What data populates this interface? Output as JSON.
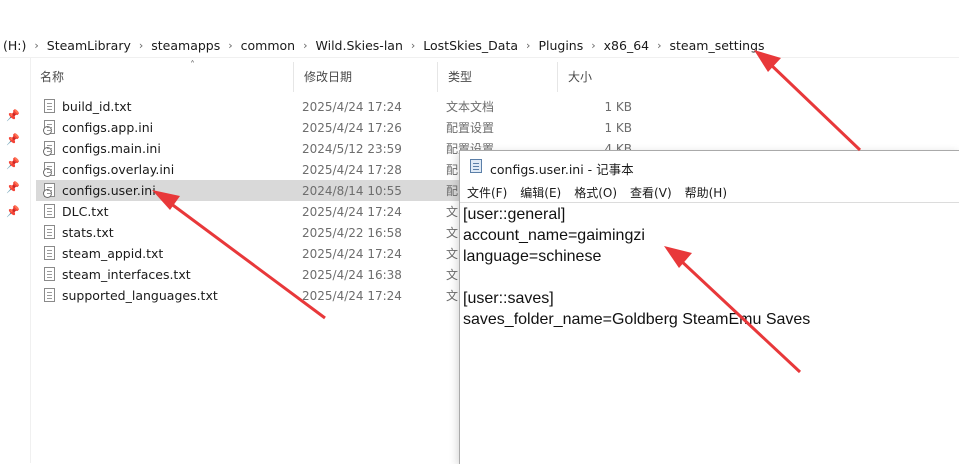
{
  "address": {
    "crumbs": [
      "(H:)",
      "SteamLibrary",
      "steamapps",
      "common",
      "Wild.Skies-lan",
      "LostSkies_Data",
      "Plugins",
      "x86_64",
      "steam_settings"
    ]
  },
  "columns": {
    "name": "名称",
    "date": "修改日期",
    "type": "类型",
    "size": "大小"
  },
  "files": [
    {
      "name": "build_id.txt",
      "date": "2025/4/24 17:24",
      "type": "文本文档",
      "size": "1 KB",
      "icon": "text-file-icon"
    },
    {
      "name": "configs.app.ini",
      "date": "2025/4/24 17:26",
      "type": "配置设置",
      "size": "1 KB",
      "icon": "settings-file-icon"
    },
    {
      "name": "configs.main.ini",
      "date": "2024/5/12 23:59",
      "type": "配置设置",
      "size": "4 KB",
      "icon": "settings-file-icon"
    },
    {
      "name": "configs.overlay.ini",
      "date": "2025/4/24 17:28",
      "type": "配",
      "size": "",
      "icon": "settings-file-icon"
    },
    {
      "name": "configs.user.ini",
      "date": "2024/8/14 10:55",
      "type": "配",
      "size": "",
      "icon": "settings-file-icon",
      "selected": true
    },
    {
      "name": "DLC.txt",
      "date": "2025/4/24 17:24",
      "type": "文",
      "size": "",
      "icon": "text-file-icon"
    },
    {
      "name": "stats.txt",
      "date": "2025/4/22 16:58",
      "type": "文",
      "size": "",
      "icon": "text-file-icon"
    },
    {
      "name": "steam_appid.txt",
      "date": "2025/4/24 17:24",
      "type": "文",
      "size": "",
      "icon": "text-file-icon"
    },
    {
      "name": "steam_interfaces.txt",
      "date": "2025/4/24 16:38",
      "type": "文",
      "size": "",
      "icon": "text-file-icon"
    },
    {
      "name": "supported_languages.txt",
      "date": "2025/4/24 17:24",
      "type": "文",
      "size": "",
      "icon": "text-file-icon"
    }
  ],
  "notepad": {
    "title": "configs.user.ini - 记事本",
    "menu": [
      "文件(F)",
      "编辑(E)",
      "格式(O)",
      "查看(V)",
      "帮助(H)"
    ],
    "lines": [
      "[user::general]",
      "account_name=gaimingzi",
      "language=schinese",
      "",
      "[user::saves]",
      "saves_folder_name=Goldberg SteamEmu Saves"
    ]
  },
  "colors": {
    "selection": "#d9d9d9",
    "arrow": "#e8383a"
  }
}
